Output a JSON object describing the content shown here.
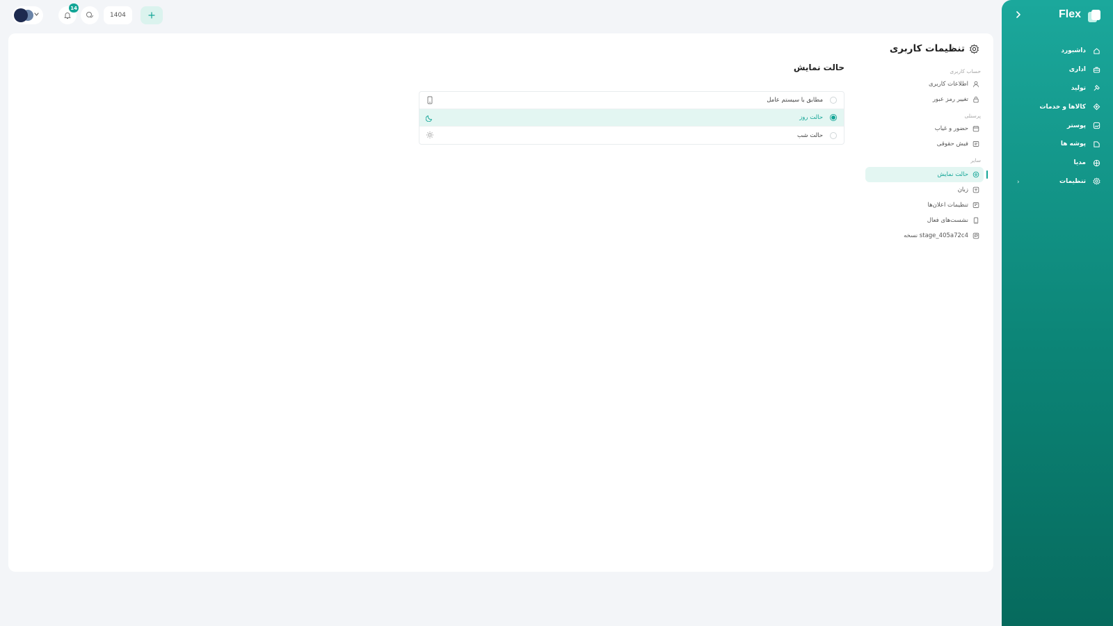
{
  "app": {
    "logo_text": "Flex"
  },
  "sidebar": {
    "items": [
      {
        "label": "داشبورد",
        "icon": "home-icon"
      },
      {
        "label": "اداری",
        "icon": "briefcase-icon"
      },
      {
        "label": "تولید",
        "icon": "production-icon"
      },
      {
        "label": "کالاها و خدمات",
        "icon": "goods-icon"
      },
      {
        "label": "پوستر",
        "icon": "poster-icon"
      },
      {
        "label": "پوشه ها",
        "icon": "folder-icon"
      },
      {
        "label": "مدیا",
        "icon": "media-icon"
      },
      {
        "label": "تنظیمات",
        "icon": "settings-icon",
        "expandable": true
      }
    ]
  },
  "topbar": {
    "notifications_count": "14",
    "year": "1404"
  },
  "page": {
    "title": "تنظیمات کاربری"
  },
  "settings_nav": {
    "sections": [
      {
        "title": "حساب کاربری",
        "items": [
          "اطلاعات کاربری",
          "تغییر رمز عبور"
        ]
      },
      {
        "title": "پرسنلی",
        "items": [
          "حضور و غیاب",
          "فیش حقوقی"
        ]
      },
      {
        "title": "سایر",
        "items": [
          "حالت نمایش",
          "زبان",
          "تنظیمات اعلان‌ها",
          "نشست‌های فعال",
          "نسخه stage_405a72c4"
        ]
      }
    ],
    "active": "حالت نمایش"
  },
  "display_mode": {
    "title": "حالت نمایش",
    "options": [
      {
        "label": "مطابق با سیستم عامل",
        "icon": "device-icon",
        "selected": false
      },
      {
        "label": "حالت روز",
        "icon": "moon-icon",
        "selected": true
      },
      {
        "label": "حالت شب",
        "icon": "sun-icon",
        "selected": false
      }
    ]
  },
  "colors": {
    "accent": "#12a596",
    "sidebar_top": "#1ba89c",
    "sidebar_bottom": "#066a5d",
    "active_bg": "#e3f6f2"
  }
}
